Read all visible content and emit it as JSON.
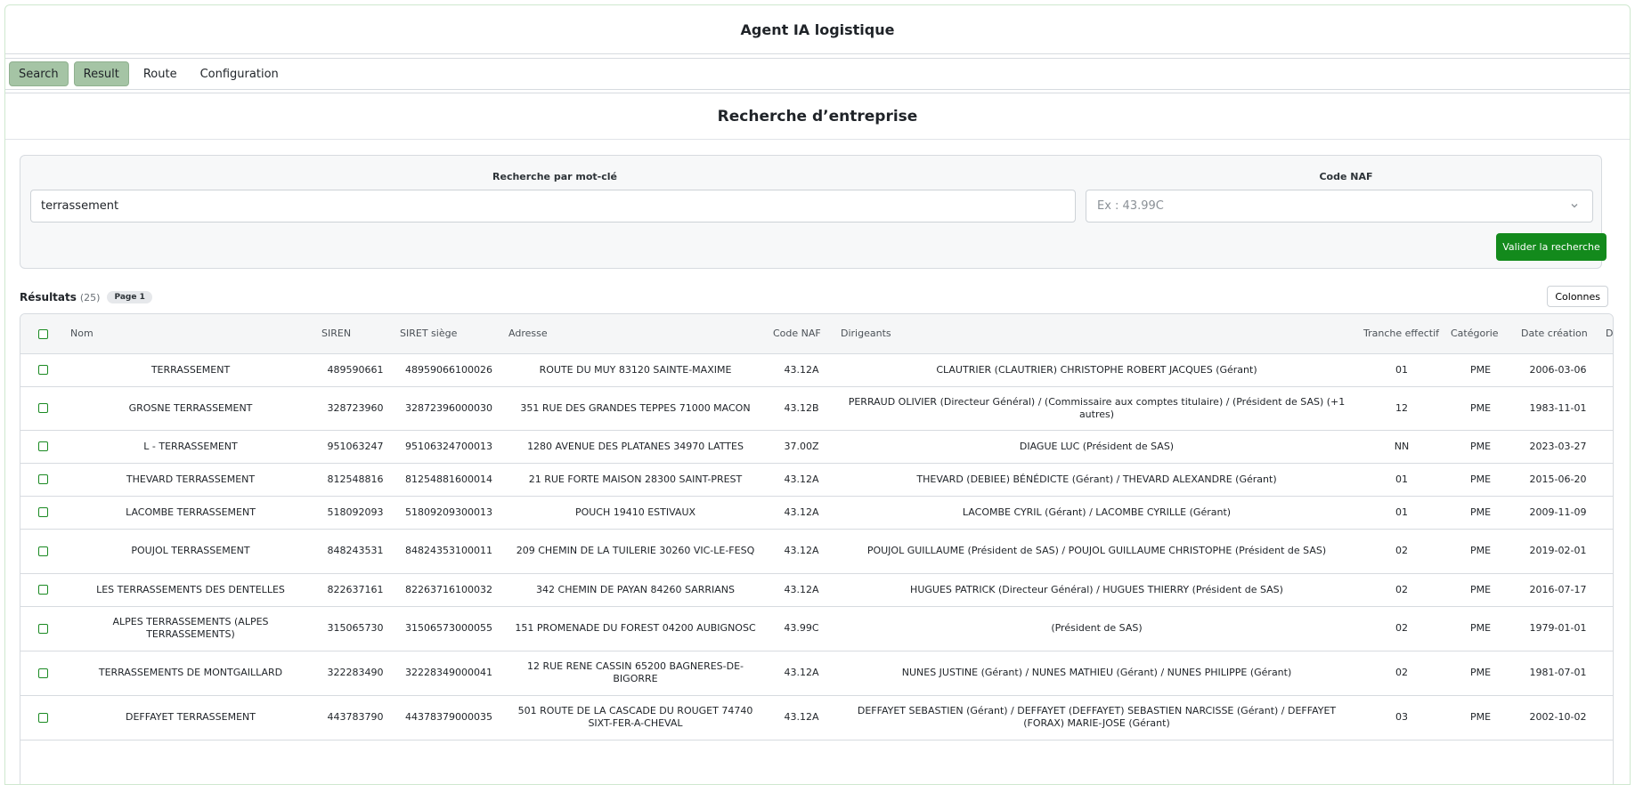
{
  "app": {
    "title": "Agent IA logistique"
  },
  "tabs": [
    {
      "label": "Search",
      "active": true
    },
    {
      "label": "Result",
      "active": true
    },
    {
      "label": "Route",
      "active": false
    },
    {
      "label": "Configuration",
      "active": false
    }
  ],
  "page": {
    "title": "Recherche d’entreprise"
  },
  "search": {
    "keyword_label": "Recherche par mot-clé",
    "keyword_value": "terrassement",
    "naf_label": "Code NAF",
    "naf_placeholder": "Ex : 43.99C",
    "submit_label": "Valider la recherche"
  },
  "results": {
    "title": "Résultats",
    "count": "(25)",
    "page_badge": "Page 1",
    "columns_button": "Colonnes"
  },
  "table": {
    "headers": {
      "nom": "Nom",
      "siren": "SIREN",
      "siret": "SIRET siège",
      "adresse": "Adresse",
      "naf": "Code NAF",
      "dirigeants": "Dirigeants",
      "tranche": "Tranche effectif",
      "categorie": "Catégorie",
      "creation": "Date création",
      "fermeture": "Date fermeture"
    },
    "rows": [
      {
        "nom": "TERRASSEMENT",
        "siren": "489590661",
        "siret": "48959066100026",
        "adresse": "ROUTE DU MUY 83120 SAINTE-MAXIME",
        "naf": "43.12A",
        "dirigeants": "CLAUTRIER (CLAUTRIER) CHRISTOPHE ROBERT JACQUES (Gérant)",
        "tranche": "01",
        "categorie": "PME",
        "creation": "2006-03-06",
        "fermeture": "—"
      },
      {
        "nom": "GROSNE TERRASSEMENT",
        "siren": "328723960",
        "siret": "32872396000030",
        "adresse": "351 RUE DES GRANDES TEPPES 71000 MACON",
        "naf": "43.12B",
        "dirigeants": "PERRAUD OLIVIER (Directeur Général) / (Commissaire aux comptes titulaire) / (Président de SAS) (+1 autres)",
        "tranche": "12",
        "categorie": "PME",
        "creation": "1983-11-01",
        "fermeture": "—"
      },
      {
        "nom": "L - TERRASSEMENT",
        "siren": "951063247",
        "siret": "95106324700013",
        "adresse": "1280 AVENUE DES PLATANES 34970 LATTES",
        "naf": "37.00Z",
        "dirigeants": "DIAGUE LUC (Président de SAS)",
        "tranche": "NN",
        "categorie": "PME",
        "creation": "2023-03-27",
        "fermeture": "—"
      },
      {
        "nom": "THEVARD TERRASSEMENT",
        "siren": "812548816",
        "siret": "81254881600014",
        "adresse": "21 RUE FORTE MAISON 28300 SAINT-PREST",
        "naf": "43.12A",
        "dirigeants": "THEVARD (DEBIEE) BÉNÉDICTE (Gérant) / THEVARD ALEXANDRE (Gérant)",
        "tranche": "01",
        "categorie": "PME",
        "creation": "2015-06-20",
        "fermeture": "—"
      },
      {
        "nom": "LACOMBE TERRASSEMENT",
        "siren": "518092093",
        "siret": "51809209300013",
        "adresse": "POUCH 19410 ESTIVAUX",
        "naf": "43.12A",
        "dirigeants": "LACOMBE CYRIL (Gérant) / LACOMBE CYRILLE (Gérant)",
        "tranche": "01",
        "categorie": "PME",
        "creation": "2009-11-09",
        "fermeture": "—"
      },
      {
        "nom": "POUJOL TERRASSEMENT",
        "siren": "848243531",
        "siret": "84824353100011",
        "adresse": "209 CHEMIN DE LA TUILERIE 30260 VIC-LE-FESQ",
        "naf": "43.12A",
        "dirigeants": "POUJOL GUILLAUME (Président de SAS) / POUJOL GUILLAUME CHRISTOPHE (Président de SAS)",
        "tranche": "02",
        "categorie": "PME",
        "creation": "2019-02-01",
        "fermeture": "—"
      },
      {
        "nom": "LES TERRASSEMENTS DES DENTELLES",
        "siren": "822637161",
        "siret": "82263716100032",
        "adresse": "342 CHEMIN DE PAYAN 84260 SARRIANS",
        "naf": "43.12A",
        "dirigeants": "HUGUES PATRICK (Directeur Général) / HUGUES THIERRY (Président de SAS)",
        "tranche": "02",
        "categorie": "PME",
        "creation": "2016-07-17",
        "fermeture": "—"
      },
      {
        "nom": "ALPES TERRASSEMENTS (ALPES TERRASSEMENTS)",
        "siren": "315065730",
        "siret": "31506573000055",
        "adresse": "151 PROMENADE DU FOREST 04200 AUBIGNOSC",
        "naf": "43.99C",
        "dirigeants": "(Président de SAS)",
        "tranche": "02",
        "categorie": "PME",
        "creation": "1979-01-01",
        "fermeture": "—"
      },
      {
        "nom": "TERRASSEMENTS DE MONTGAILLARD",
        "siren": "322283490",
        "siret": "32228349000041",
        "adresse": "12 RUE RENE CASSIN 65200 BAGNERES-DE-BIGORRE",
        "naf": "43.12A",
        "dirigeants": "NUNES JUSTINE (Gérant) / NUNES MATHIEU (Gérant) / NUNES PHILIPPE (Gérant)",
        "tranche": "02",
        "categorie": "PME",
        "creation": "1981-07-01",
        "fermeture": "—"
      },
      {
        "nom": "DEFFAYET TERRASSEMENT",
        "siren": "443783790",
        "siret": "44378379000035",
        "adresse": "501 ROUTE DE LA CASCADE DU ROUGET 74740 SIXT-FER-A-CHEVAL",
        "naf": "43.12A",
        "dirigeants": "DEFFAYET SEBASTIEN (Gérant) / DEFFAYET (DEFFAYET) SEBASTIEN NARCISSE (Gérant) / DEFFAYET (FORAX) MARIE-JOSE (Gérant)",
        "tranche": "03",
        "categorie": "PME",
        "creation": "2002-10-02",
        "fermeture": "—"
      }
    ]
  },
  "colors": {
    "tab_active": "#a5c4a5",
    "primary_button": "#138a1c",
    "checkbox": "#1a8a22"
  }
}
